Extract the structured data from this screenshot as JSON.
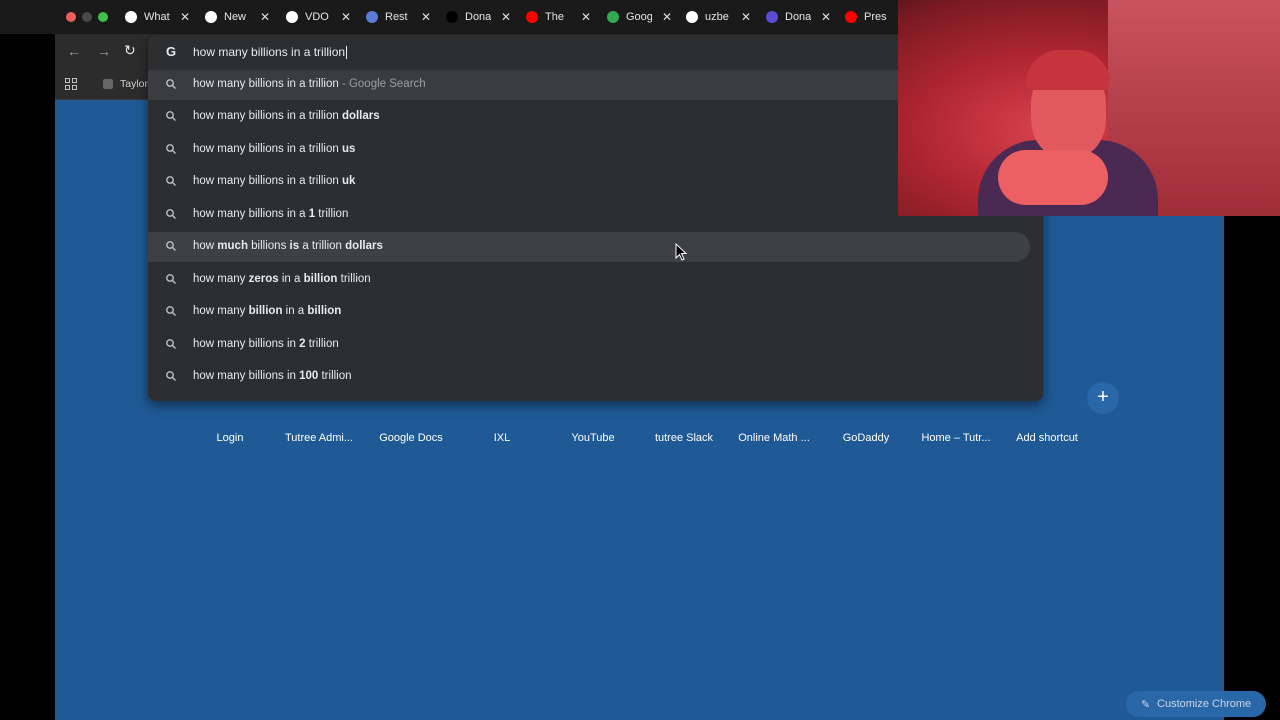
{
  "tabs": [
    {
      "title": "What",
      "icon": "chrome-icon",
      "color": "#ffffff"
    },
    {
      "title": "New",
      "icon": "chrome-icon",
      "color": "#ffffff"
    },
    {
      "title": "VDO",
      "icon": "vdo-icon",
      "color": "#ffffff"
    },
    {
      "title": "Rest",
      "icon": "r-icon",
      "color": "#5b7bd5"
    },
    {
      "title": "Dona",
      "icon": "x-icon",
      "color": "#000000"
    },
    {
      "title": "The",
      "icon": "youtube-icon",
      "color": "#ff0000"
    },
    {
      "title": "Goog",
      "icon": "maps-pin-icon",
      "color": "#34a853"
    },
    {
      "title": "uzbe",
      "icon": "google-icon",
      "color": "#ffffff"
    },
    {
      "title": "Dona",
      "icon": "t-icon",
      "color": "#5b4bd5"
    },
    {
      "title": "Pres",
      "icon": "youtube-icon",
      "color": "#ff0000"
    }
  ],
  "bookmarks": {
    "first": "Taylor"
  },
  "omnibox": {
    "g_glyph": "G",
    "query": "how many billions in a trillion"
  },
  "suggestions": [
    {
      "parts": [
        {
          "t": "how many billions in a trillion",
          "b": false
        }
      ],
      "suffix": " - Google Search"
    },
    {
      "parts": [
        {
          "t": "how many billions in a trillion ",
          "b": false
        },
        {
          "t": "dollars",
          "b": true
        }
      ]
    },
    {
      "parts": [
        {
          "t": "how many billions in a trillion ",
          "b": false
        },
        {
          "t": "us",
          "b": true
        }
      ]
    },
    {
      "parts": [
        {
          "t": "how many billions in a trillion ",
          "b": false
        },
        {
          "t": "uk",
          "b": true
        }
      ]
    },
    {
      "parts": [
        {
          "t": "how many billions in a ",
          "b": false
        },
        {
          "t": "1",
          "b": true
        },
        {
          "t": " trillion",
          "b": false
        }
      ]
    },
    {
      "parts": [
        {
          "t": "how ",
          "b": false
        },
        {
          "t": "much",
          "b": true
        },
        {
          "t": " billions ",
          "b": false
        },
        {
          "t": "is",
          "b": true
        },
        {
          "t": " a trillion ",
          "b": false
        },
        {
          "t": "dollars",
          "b": true
        }
      ]
    },
    {
      "parts": [
        {
          "t": "how many ",
          "b": false
        },
        {
          "t": "zeros",
          "b": true
        },
        {
          "t": " in a ",
          "b": false
        },
        {
          "t": "billion",
          "b": true
        },
        {
          "t": " trillion",
          "b": false
        }
      ]
    },
    {
      "parts": [
        {
          "t": "how many ",
          "b": false
        },
        {
          "t": "billion",
          "b": true
        },
        {
          "t": " in a ",
          "b": false
        },
        {
          "t": "billion",
          "b": true
        }
      ]
    },
    {
      "parts": [
        {
          "t": "how many billions in ",
          "b": false
        },
        {
          "t": "2",
          "b": true
        },
        {
          "t": " trillion",
          "b": false
        }
      ]
    },
    {
      "parts": [
        {
          "t": "how many billions in ",
          "b": false
        },
        {
          "t": "100",
          "b": true
        },
        {
          "t": " trillion",
          "b": false
        }
      ]
    }
  ],
  "shortcuts": [
    {
      "label": "Login",
      "color": "#2e9a4a"
    },
    {
      "label": "Tutree Admi...",
      "color": "#d9532b"
    },
    {
      "label": "Google Docs",
      "color": "#3b78e7"
    },
    {
      "label": "IXL",
      "color": "#8bc34a"
    },
    {
      "label": "YouTube",
      "color": "#e02020"
    },
    {
      "label": "tutree Slack",
      "color": "#c4457a"
    },
    {
      "label": "Online Math ...",
      "color": "#d0d0d0"
    },
    {
      "label": "GoDaddy",
      "color": "#1ba39c"
    },
    {
      "label": "Home – Tutr...",
      "color": "#6a4bd0"
    }
  ],
  "add_shortcut": {
    "label": "Add shortcut",
    "glyph": "+"
  },
  "customize": {
    "label": "Customize Chrome"
  }
}
